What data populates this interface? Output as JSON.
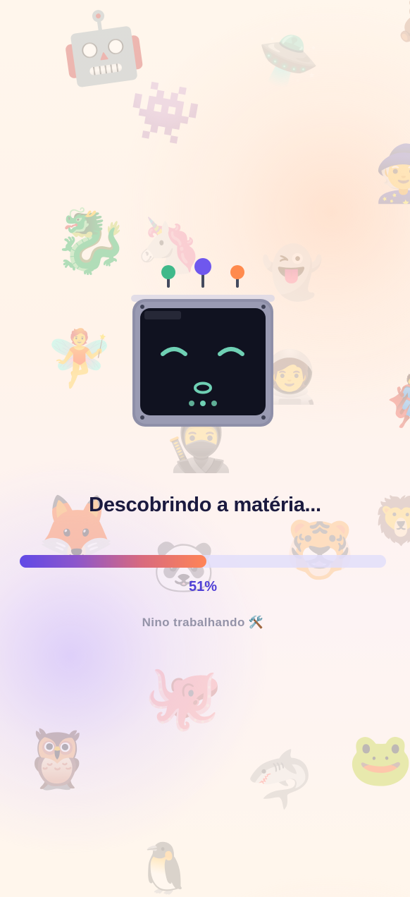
{
  "background_emojis": [
    {
      "name": "robot-face-icon",
      "char": "🤖"
    },
    {
      "name": "ufo-icon",
      "char": "🛸"
    },
    {
      "name": "alien-monster-icon",
      "char": "👾"
    },
    {
      "name": "mage-icon",
      "char": "🧙"
    },
    {
      "name": "dragon-icon",
      "char": "🐉"
    },
    {
      "name": "unicorn-icon",
      "char": "🦄"
    },
    {
      "name": "ghost-icon",
      "char": "👻"
    },
    {
      "name": "fairy-icon",
      "char": "🧚"
    },
    {
      "name": "astronaut-icon",
      "char": "🧑‍🚀"
    },
    {
      "name": "superhero-icon",
      "char": "🦸"
    },
    {
      "name": "ninja-icon",
      "char": "🥷"
    },
    {
      "name": "fox-icon",
      "char": "🦊"
    },
    {
      "name": "tiger-icon",
      "char": "🐯"
    },
    {
      "name": "lion-icon",
      "char": "🦁"
    },
    {
      "name": "panda-icon",
      "char": "🐼"
    },
    {
      "name": "octopus-icon",
      "char": "🐙"
    },
    {
      "name": "owl-icon",
      "char": "🦉"
    },
    {
      "name": "shark-icon",
      "char": "🦈"
    },
    {
      "name": "frog-icon",
      "char": "🐸"
    },
    {
      "name": "penguin-icon",
      "char": "🐧"
    },
    {
      "name": "partial-emoji-icon",
      "char": "🧸"
    }
  ],
  "loader": {
    "title": "Descobrindo a matéria...",
    "progress": 0.51,
    "percent_label": "51%",
    "status": "Nino trabalhando 🛠️"
  },
  "colors": {
    "antenna_left": "#3fb98a",
    "antenna_center": "#6f57ee",
    "antenna_right": "#ff8a4d",
    "screen_face": "#6fd0b4",
    "progress_start": "#6149e6",
    "progress_end": "#ff8456",
    "title": "#1b1a3f",
    "percent": "#4f3fd6"
  }
}
